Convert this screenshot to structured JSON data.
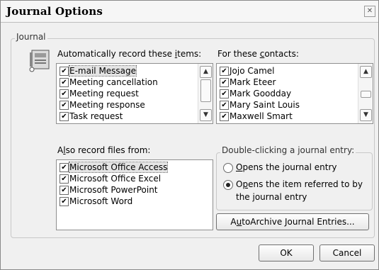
{
  "dialog": {
    "title": "Journal Options",
    "close_glyph": "✕"
  },
  "journal_group": {
    "label": "Journal"
  },
  "items_section": {
    "label_pre": "Automatically record these ",
    "label_ul": "i",
    "label_post": "tems:",
    "items": [
      {
        "label": "E-mail Message",
        "checked": true,
        "selected": true
      },
      {
        "label": "Meeting cancellation",
        "checked": true
      },
      {
        "label": "Meeting request",
        "checked": true
      },
      {
        "label": "Meeting response",
        "checked": true
      },
      {
        "label": "Task request",
        "checked": true
      }
    ]
  },
  "contacts_section": {
    "label_pre": "For these ",
    "label_ul": "c",
    "label_post": "ontacts:",
    "contacts": [
      {
        "label": "Jojo Camel",
        "checked": true
      },
      {
        "label": "Mark Eteer",
        "checked": true
      },
      {
        "label": "Mark Goodday",
        "checked": true
      },
      {
        "label": "Mary Saint Louis",
        "checked": true
      },
      {
        "label": "Maxwell Smart",
        "checked": true
      }
    ]
  },
  "files_section": {
    "label_pre": "A",
    "label_ul": "l",
    "label_post": "so record files from:",
    "files": [
      {
        "label": "Microsoft Office Access",
        "checked": true,
        "selected": true
      },
      {
        "label": "Microsoft Office Excel",
        "checked": true
      },
      {
        "label": "Microsoft PowerPoint",
        "checked": true
      },
      {
        "label": "Microsoft Word",
        "checked": true
      }
    ]
  },
  "double_click_group": {
    "label": "Double-clicking a journal entry:",
    "options": [
      {
        "ul": "O",
        "rest": "pens the journal entry",
        "selected": false
      },
      {
        "pre": "O",
        "ul": "p",
        "rest": "ens the item referred to by",
        "line2": "the journal entry",
        "selected": true
      }
    ]
  },
  "buttons": {
    "autoarchive": {
      "pre": "A",
      "ul": "u",
      "post": "toArchive Journal Entries..."
    },
    "ok": "OK",
    "cancel": "Cancel"
  },
  "glyphs": {
    "check": "✔",
    "up": "▲",
    "down": "▼"
  },
  "icons": {
    "journal": "journal-icon",
    "close": "close-icon"
  }
}
